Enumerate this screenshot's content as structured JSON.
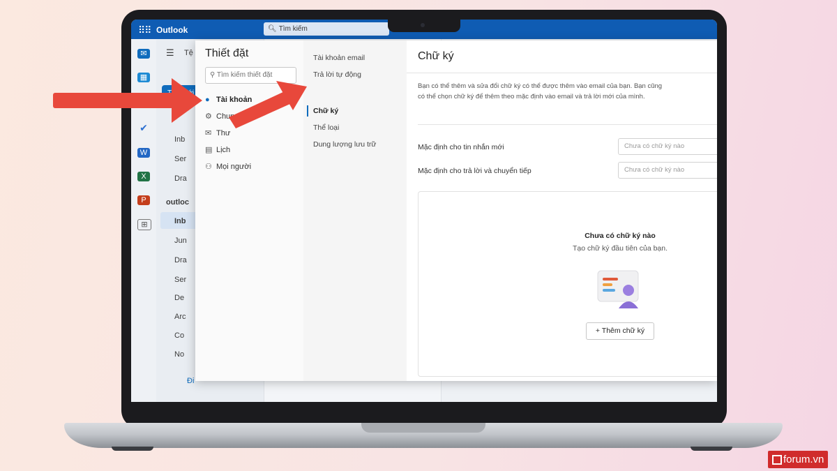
{
  "outlook": {
    "app_name": "Outlook",
    "search_placeholder": "Tìm kiếm",
    "search_icon": "search-icon",
    "new_mail_label": "Thư mới",
    "folders_partial": [
      "Tệ",
      "Inb",
      "Ser",
      "Dra",
      "outloc",
      "Inb",
      "Jun",
      "Dra",
      "Ser",
      "De",
      "Arc",
      "Co",
      "No",
      "Đi"
    ]
  },
  "settings": {
    "title": "Thiết đặt",
    "search_placeholder": "Tìm kiếm thiết đặt",
    "nav": [
      {
        "label": "Tài khoản",
        "icon": "person-icon",
        "selected": true
      },
      {
        "label": "Chung",
        "icon": "gear-icon",
        "selected": false
      },
      {
        "label": "Thư",
        "icon": "mail-icon",
        "selected": false
      },
      {
        "label": "Lịch",
        "icon": "calendar-icon",
        "selected": false
      },
      {
        "label": "Mọi người",
        "icon": "people-icon",
        "selected": false
      }
    ],
    "subnav": [
      {
        "label": "Tài khoản email",
        "selected": false
      },
      {
        "label": "Trả lời tự động",
        "selected": false
      },
      {
        "label": "Chữ ký",
        "selected": true
      },
      {
        "label": "Thể loại",
        "selected": false
      },
      {
        "label": "Dung lượng lưu trữ",
        "selected": false
      }
    ]
  },
  "signature": {
    "title": "Chữ ký",
    "description": "Bạn có thể thêm và sửa đổi chữ ký có thể được thêm vào email của bạn. Bạn cũng có thể chọn chữ ký để thêm theo mặc định vào email và trả lời mới của mình.",
    "default_new_label": "Mặc định cho tin nhắn mới",
    "default_new_value": "Chưa có chữ ký nào",
    "default_reply_label": "Mặc định cho trả lời và chuyển tiếp",
    "default_reply_value": "Chưa có chữ ký nào",
    "empty_title": "Chưa có chữ ký nào",
    "empty_subtitle": "Tạo chữ ký đầu tiên của bạn.",
    "add_button": "Thêm chữ ký"
  },
  "watermark": "forum.vn",
  "colors": {
    "accent": "#0f6cbd",
    "topbar": "#0f5cb3",
    "arrow": "#e8483b",
    "brand": "#d02c2c"
  }
}
